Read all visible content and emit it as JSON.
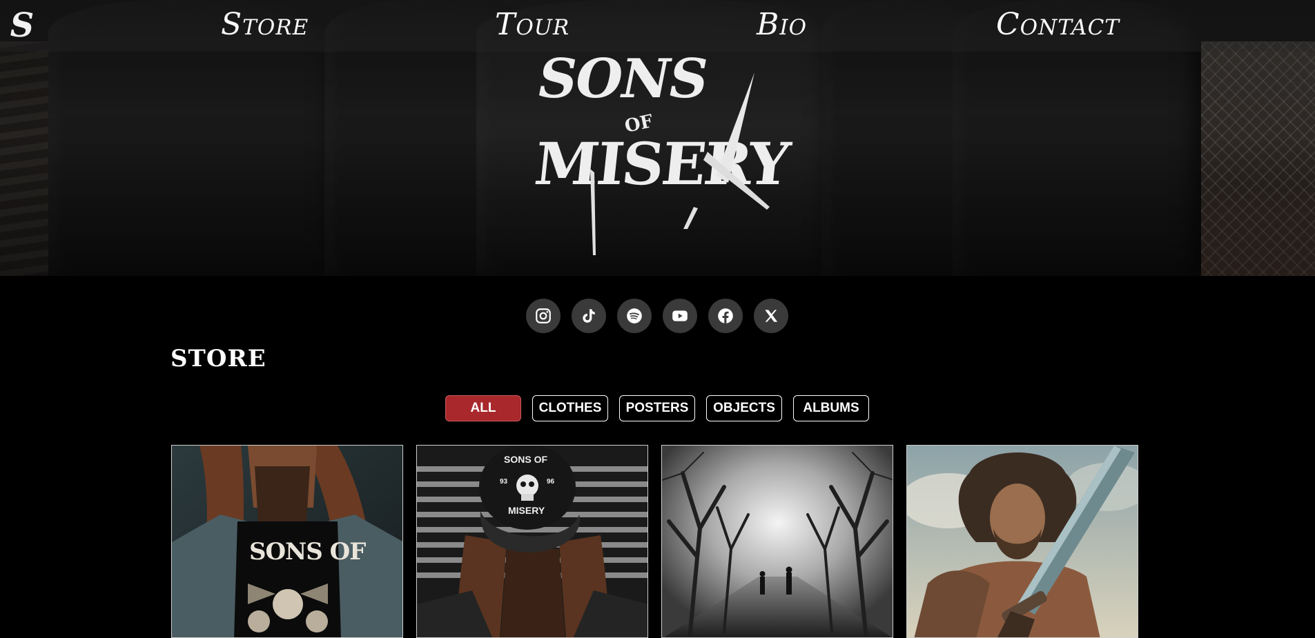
{
  "nav": {
    "logo_letter": "S",
    "links": [
      "Store",
      "Tour",
      "Bio",
      "Contact"
    ]
  },
  "hero": {
    "band_name_top": "SONS",
    "band_name_of": "OF",
    "band_name_bottom": "MISERY"
  },
  "social": {
    "icons": [
      "instagram-icon",
      "tiktok-icon",
      "spotify-icon",
      "youtube-icon",
      "facebook-icon",
      "x-icon"
    ]
  },
  "store": {
    "heading": "STORE",
    "filters": [
      "ALL",
      "CLOTHES",
      "POSTERS",
      "OBJECTS",
      "ALBUMS"
    ],
    "active_filter": "ALL",
    "accent_color": "#a8282c",
    "products": [
      {
        "image": "long-haired-man-wearing-band-shirt",
        "print": "SONS OF"
      },
      {
        "image": "bearded-man-wearing-band-cap",
        "cap_top": "SONS OF",
        "cap_left": "93",
        "cap_right": "96",
        "cap_bottom": "MISERY"
      },
      {
        "image": "two-figures-in-misty-forest-poster"
      },
      {
        "image": "warrior-with-sword-poster"
      }
    ]
  }
}
